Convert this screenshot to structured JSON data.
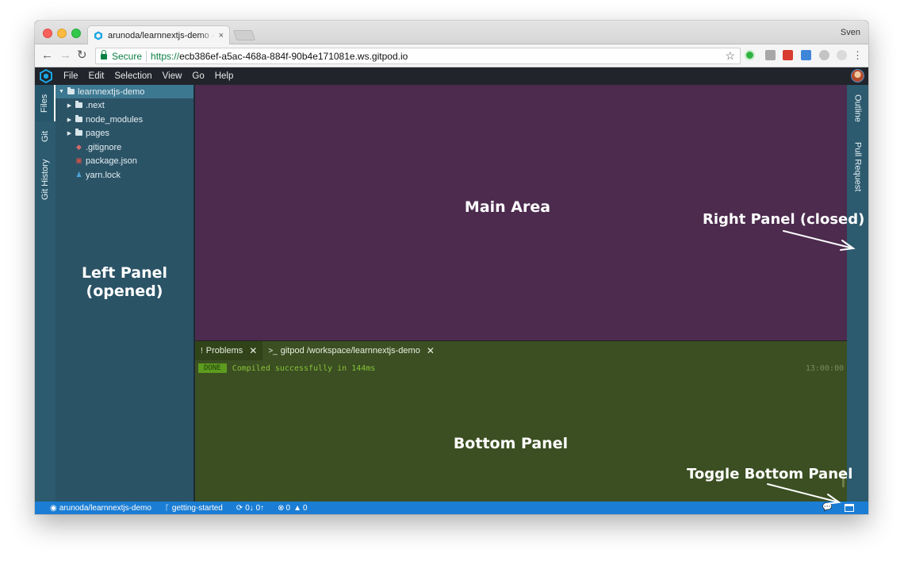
{
  "browser": {
    "tab_title": "arunoda/learnnextjs-demo - gitpod",
    "tab_close": "×",
    "profile_name": "Sven",
    "secure_label": "Secure",
    "url_scheme": "https://",
    "url_rest": "ecb386ef-a5ac-468a-884f-90b4e171081e.ws.gitpod.io",
    "nav": {
      "back": "←",
      "forward": "→",
      "reload": "↻"
    },
    "star": "☆",
    "menu": "⋮"
  },
  "ide": {
    "menu_items": [
      "File",
      "Edit",
      "Selection",
      "View",
      "Go",
      "Help"
    ],
    "left_activity": [
      "Files",
      "Git",
      "Git History"
    ],
    "right_activity": [
      "Outline",
      "Pull Request"
    ],
    "file_tree": {
      "root": "learnnextjs-demo",
      "items": [
        {
          "label": ".next",
          "type": "folder"
        },
        {
          "label": "node_modules",
          "type": "folder"
        },
        {
          "label": "pages",
          "type": "folder"
        },
        {
          "label": ".gitignore",
          "type": "file",
          "icon": "diamond"
        },
        {
          "label": "package.json",
          "type": "file",
          "icon": "npm"
        },
        {
          "label": "yarn.lock",
          "type": "file",
          "icon": "yarn"
        }
      ]
    },
    "bottom_tabs": [
      {
        "label": "Problems",
        "icon": "!"
      },
      {
        "label": "gitpod /workspace/learnnextjs-demo",
        "icon": ">_"
      }
    ],
    "terminal": {
      "badge": "DONE",
      "message": "Compiled successfully in 144ms",
      "time": "13:00:00"
    },
    "status": {
      "repo": "arunoda/learnnextjs-demo",
      "branch": "getting-started",
      "sync": "0↓ 0↑",
      "errors": "0",
      "warnings": "0"
    }
  },
  "annotations": {
    "left_panel_line1": "Left Panel",
    "left_panel_line2": "(opened)",
    "main_area": "Main Area",
    "right_panel": "Right Panel (closed)",
    "bottom_panel": "Bottom Panel",
    "toggle_bottom": "Toggle Bottom Panel"
  },
  "colors": {
    "main_area": "#4c2b4e",
    "bottom_panel": "#3b4f22",
    "side_panels": "#2b5366",
    "status_bar": "#1b7dd3"
  }
}
